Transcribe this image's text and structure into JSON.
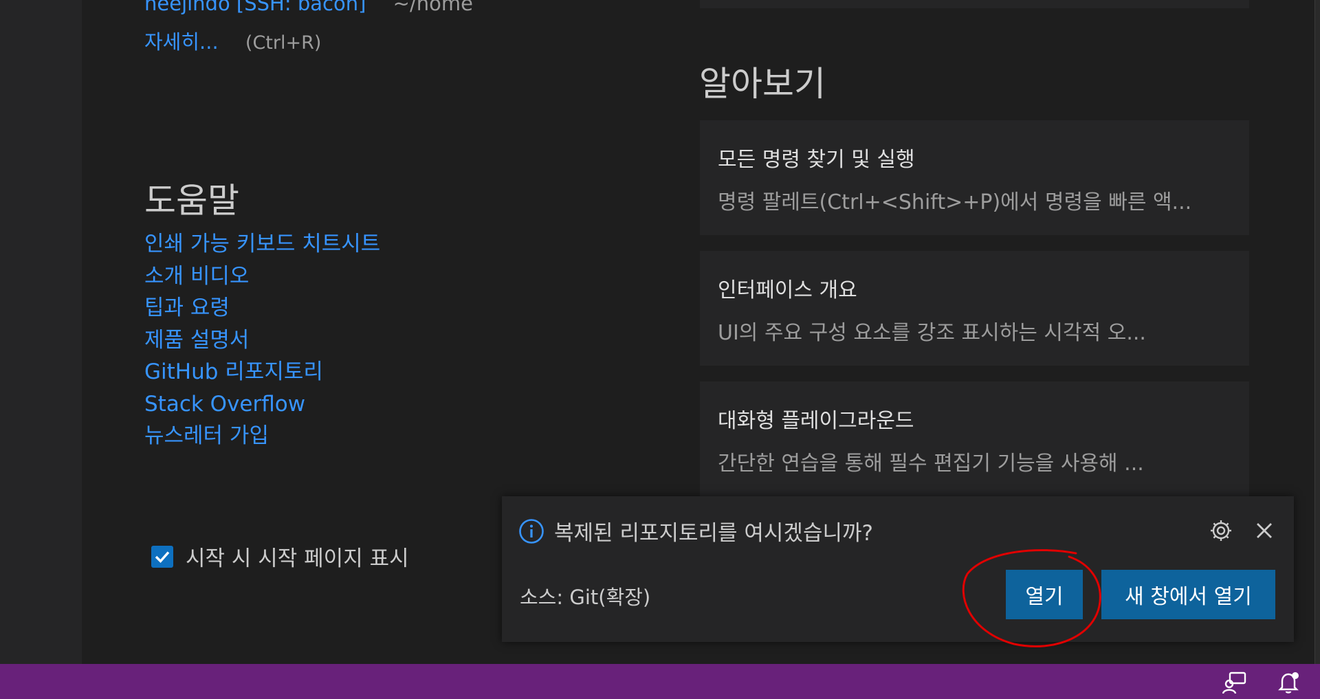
{
  "recent": {
    "last_item_name": "heejindo [SSH: bacon]",
    "last_item_path": "~/home",
    "more_label": "자세히...",
    "more_shortcut": "(Ctrl+R)"
  },
  "help": {
    "title": "도움말",
    "links": [
      "인쇄 가능 키보드 치트시트",
      "소개 비디오",
      "팁과 요령",
      "제품 설명서",
      "GitHub 리포지토리",
      "Stack Overflow",
      "뉴스레터 가입"
    ]
  },
  "startup": {
    "checkbox_label": "시작 시 시작 페이지 표시",
    "checked": true
  },
  "learn": {
    "title": "알아보기",
    "cards": [
      {
        "title": "모든 명령 찾기 및 실행",
        "desc": "명령 팔레트(Ctrl+<Shift>+P)에서 명령을 빠른 액..."
      },
      {
        "title": "인터페이스 개요",
        "desc": "UI의 주요 구성 요소를 강조 표시하는 시각적 오..."
      },
      {
        "title": "대화형 플레이그라운드",
        "desc": "간단한 연습을 통해 필수 편집기 기능을 사용해 ..."
      }
    ]
  },
  "notification": {
    "message": "복제된 리포지토리를 여시겠습니까?",
    "source": "소스: Git(확장)",
    "open_label": "열기",
    "open_new_window_label": "새 창에서 열기"
  },
  "colors": {
    "accent": "#0e639c",
    "status_bar": "#68217a",
    "link": "#3794ff",
    "annotation": "#e00000"
  }
}
